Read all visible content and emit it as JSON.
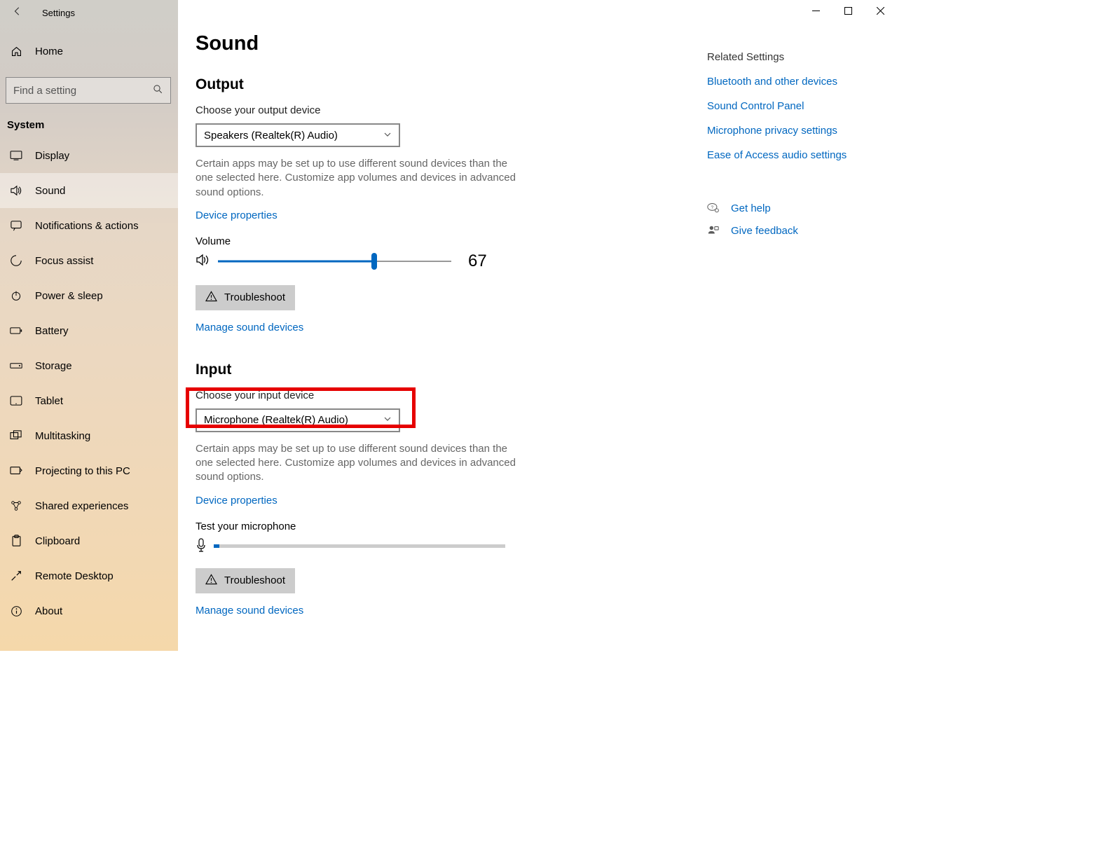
{
  "window": {
    "title": "Settings"
  },
  "sidebar": {
    "home_label": "Home",
    "search_placeholder": "Find a setting",
    "section_label": "System",
    "items": [
      {
        "label": "Display"
      },
      {
        "label": "Sound"
      },
      {
        "label": "Notifications & actions"
      },
      {
        "label": "Focus assist"
      },
      {
        "label": "Power & sleep"
      },
      {
        "label": "Battery"
      },
      {
        "label": "Storage"
      },
      {
        "label": "Tablet"
      },
      {
        "label": "Multitasking"
      },
      {
        "label": "Projecting to this PC"
      },
      {
        "label": "Shared experiences"
      },
      {
        "label": "Clipboard"
      },
      {
        "label": "Remote Desktop"
      },
      {
        "label": "About"
      }
    ]
  },
  "page": {
    "title": "Sound",
    "output": {
      "title": "Output",
      "choose_label": "Choose your output device",
      "device": "Speakers (Realtek(R) Audio)",
      "hint": "Certain apps may be set up to use different sound devices than the one selected here. Customize app volumes and devices in advanced sound options.",
      "device_properties": "Device properties",
      "volume_label": "Volume",
      "volume_value": "67",
      "volume_percent": 67,
      "troubleshoot": "Troubleshoot",
      "manage": "Manage sound devices"
    },
    "input": {
      "title": "Input",
      "choose_label": "Choose your input device",
      "device": "Microphone (Realtek(R) Audio)",
      "hint": "Certain apps may be set up to use different sound devices than the one selected here. Customize app volumes and devices in advanced sound options.",
      "device_properties": "Device properties",
      "test_label": "Test your microphone",
      "mic_level_percent": 2,
      "troubleshoot": "Troubleshoot",
      "manage": "Manage sound devices"
    }
  },
  "related": {
    "heading": "Related Settings",
    "links": [
      "Bluetooth and other devices",
      "Sound Control Panel",
      "Microphone privacy settings",
      "Ease of Access audio settings"
    ],
    "help": "Get help",
    "feedback": "Give feedback"
  }
}
